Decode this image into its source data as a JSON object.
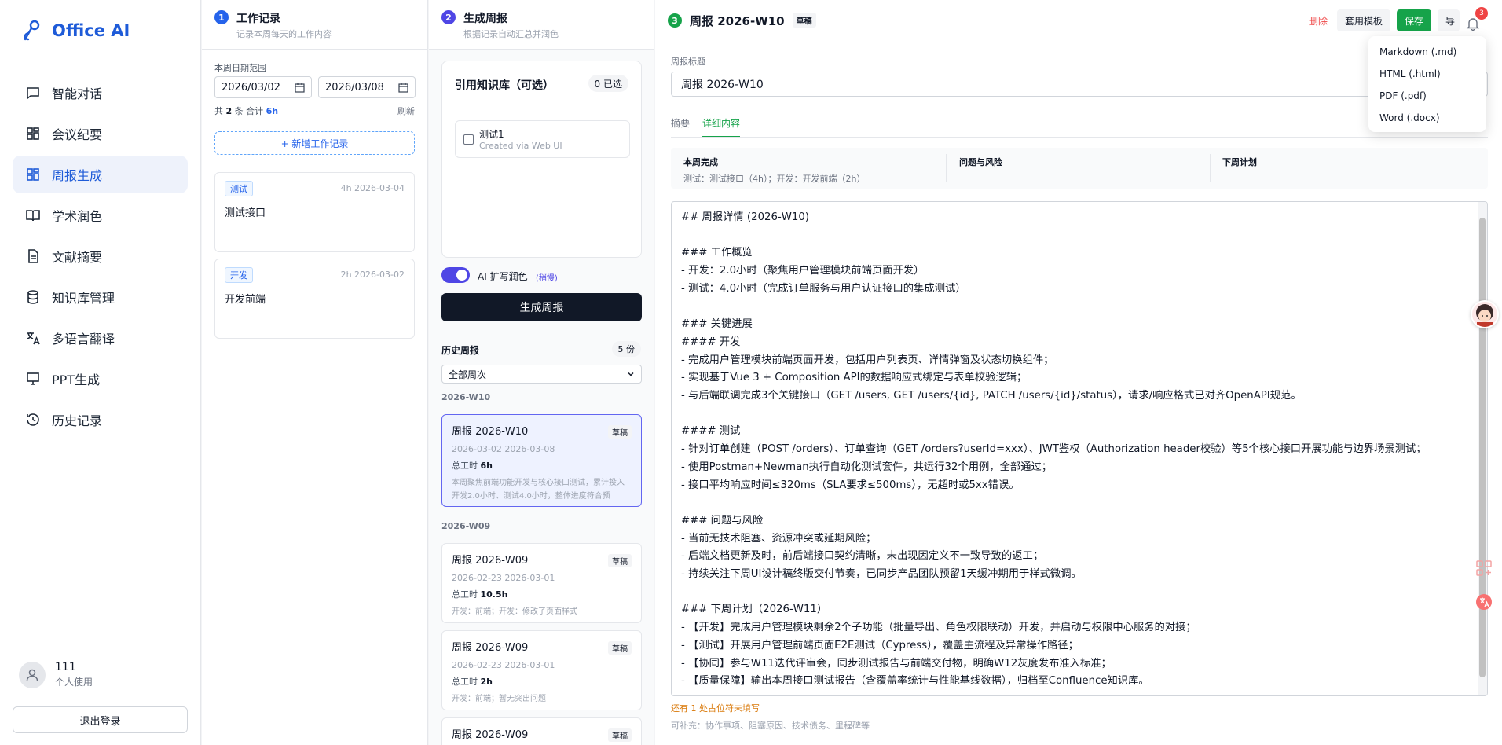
{
  "app": {
    "name": "Office AI"
  },
  "sidebar": {
    "items": [
      {
        "label": "智能对话",
        "icon": "chat-icon"
      },
      {
        "label": "会议纪要",
        "icon": "grid-icon"
      },
      {
        "label": "周报生成",
        "icon": "grid-icon",
        "active": true
      },
      {
        "label": "学术润色",
        "icon": "book-icon"
      },
      {
        "label": "文献摘要",
        "icon": "document-icon"
      },
      {
        "label": "知识库管理",
        "icon": "database-icon"
      },
      {
        "label": "多语言翻译",
        "icon": "translate-icon"
      },
      {
        "label": "PPT生成",
        "icon": "presentation-icon"
      },
      {
        "label": "历史记录",
        "icon": "history-icon"
      }
    ],
    "user": {
      "name": "111",
      "role": "个人使用"
    },
    "logout_label": "退出登录"
  },
  "panel1": {
    "step": "1",
    "title": "工作记录",
    "subtitle": "记录本周每天的工作内容",
    "date_range_label": "本周日期范围",
    "start_date": "2026/03/02",
    "end_date": "2026/03/08",
    "count_prefix": "共",
    "count": "2",
    "count_mid": "条 合计",
    "total_hours": "6h",
    "refresh_label": "刷新",
    "add_label": "+ 新增工作记录",
    "records": [
      {
        "tag": "测试",
        "meta": "4h 2026-03-04",
        "text": "测试接口"
      },
      {
        "tag": "开发",
        "meta": "2h 2026-03-02",
        "text": "开发前端"
      }
    ]
  },
  "panel2": {
    "step": "2",
    "title": "生成周报",
    "subtitle": "根据记录自动汇总并润色",
    "kb_title": "引用知识库（可选）",
    "kb_selected": "0 已选",
    "kb_items": [
      {
        "name": "测试1",
        "desc": "Created via Web UI"
      }
    ],
    "ai_label": "AI 扩写润色",
    "ai_hint": "(稍慢)",
    "generate_label": "生成周报",
    "history_title": "历史周报",
    "history_count": "5 份",
    "filter_value": "全部周次",
    "groups": [
      {
        "label": "2026-W10"
      },
      {
        "label": "2026-W09"
      }
    ],
    "history": [
      {
        "title": "周报 2026-W10",
        "badge": "草稿",
        "dates": "2026-03-02 2026-03-08",
        "hours_label": "总工时",
        "hours": "6h",
        "desc": "本周聚焦前端功能开发与核心接口测试，累计投入开发2.0小时、测试4.0小时，整体进度符合预期。..."
      },
      {
        "title": "周报 2026-W09",
        "badge": "草稿",
        "dates": "2026-02-23 2026-03-01",
        "hours_label": "总工时",
        "hours": "10.5h",
        "desc": "开发：前端；开发：修改了页面样式"
      },
      {
        "title": "周报 2026-W09",
        "badge": "草稿",
        "dates": "2026-02-23 2026-03-01",
        "hours_label": "总工时",
        "hours": "2h",
        "desc": "开发：前端；暂无突出问题"
      },
      {
        "title": "周报 2026-W09",
        "badge": "草稿"
      }
    ]
  },
  "panel3": {
    "step": "3",
    "title": "周报 2026-W10",
    "badge": "草稿",
    "delete_label": "删除",
    "template_label": "套用模板",
    "save_label": "保存",
    "export_label": "导",
    "notif_count": "3",
    "title_label": "周报标题",
    "title_value": "周报 2026-W10",
    "tabs": [
      {
        "label": "摘要"
      },
      {
        "label": "详细内容",
        "active": true
      }
    ],
    "summary": {
      "done_h": "本周完成",
      "done_v": "测试：测试接口（4h）；开发：开发前端（2h）",
      "risk_h": "问题与风险",
      "plan_h": "下周计划"
    },
    "content_lines": [
      "## 周报详情 (2026-W10)",
      "",
      "### 工作概览",
      "- 开发：2.0小时（聚焦用户管理模块前端页面开发）",
      "- 测试：4.0小时（完成订单服务与用户认证接口的集成测试）",
      "",
      "### 关键进展",
      "#### 开发",
      "- 完成用户管理模块前端页面开发，包括用户列表页、详情弹窗及状态切换组件；",
      "- 实现基于Vue 3 + Composition API的数据响应式绑定与表单校验逻辑；",
      "- 与后端联调完成3个关键接口（GET /users, GET /users/{id}, PATCH /users/{id}/status），请求/响应格式已对齐OpenAPI规范。",
      "",
      "#### 测试",
      "- 针对订单创建（POST /orders）、订单查询（GET /orders?userId=xxx）、JWT鉴权（Authorization header校验）等5个核心接口开展功能与边界场景测试；",
      "- 使用Postman+Newman执行自动化测试套件，共运行32个用例，全部通过；",
      "- 接口平均响应时间≤320ms（SLA要求≤500ms），无超时或5xx错误。",
      "",
      "### 问题与风险",
      "- 当前无技术阻塞、资源冲突或延期风险；",
      "- 后端文档更新及时，前后端接口契约清晰，未出现因定义不一致导致的返工；",
      "- 持续关注下周UI设计稿终版交付节奏，已同步产品团队预留1天缓冲期用于样式微调。",
      "",
      "### 下周计划（2026-W11）",
      "- 【开发】完成用户管理模块剩余2个子功能（批量导出、角色权限联动）开发，并启动与权限中心服务的对接；",
      "- 【测试】开展用户管理前端页面E2E测试（Cypress），覆盖主流程及异常操作路径；",
      "- 【协同】参与W11迭代评审会，同步测试报告与前端交付物，明确W12灰度发布准入标准；",
      "- 【质量保障】输出本周接口测试报告（含覆盖率统计与性能基线数据），归档至Confluence知识库。"
    ],
    "warning": "还有 1 处占位符未填写",
    "hint": "可补充：协作事项、阻塞原因、技术债务、里程碑等"
  },
  "export_menu": {
    "items": [
      {
        "label": "Markdown (.md)"
      },
      {
        "label": "HTML (.html)"
      },
      {
        "label": "PDF (.pdf)"
      },
      {
        "label": "Word (.docx)"
      }
    ]
  },
  "colors": {
    "brand": "#1e5bd8",
    "accent": "#4f46e5",
    "success": "#16a34a",
    "danger": "#ef4444"
  }
}
